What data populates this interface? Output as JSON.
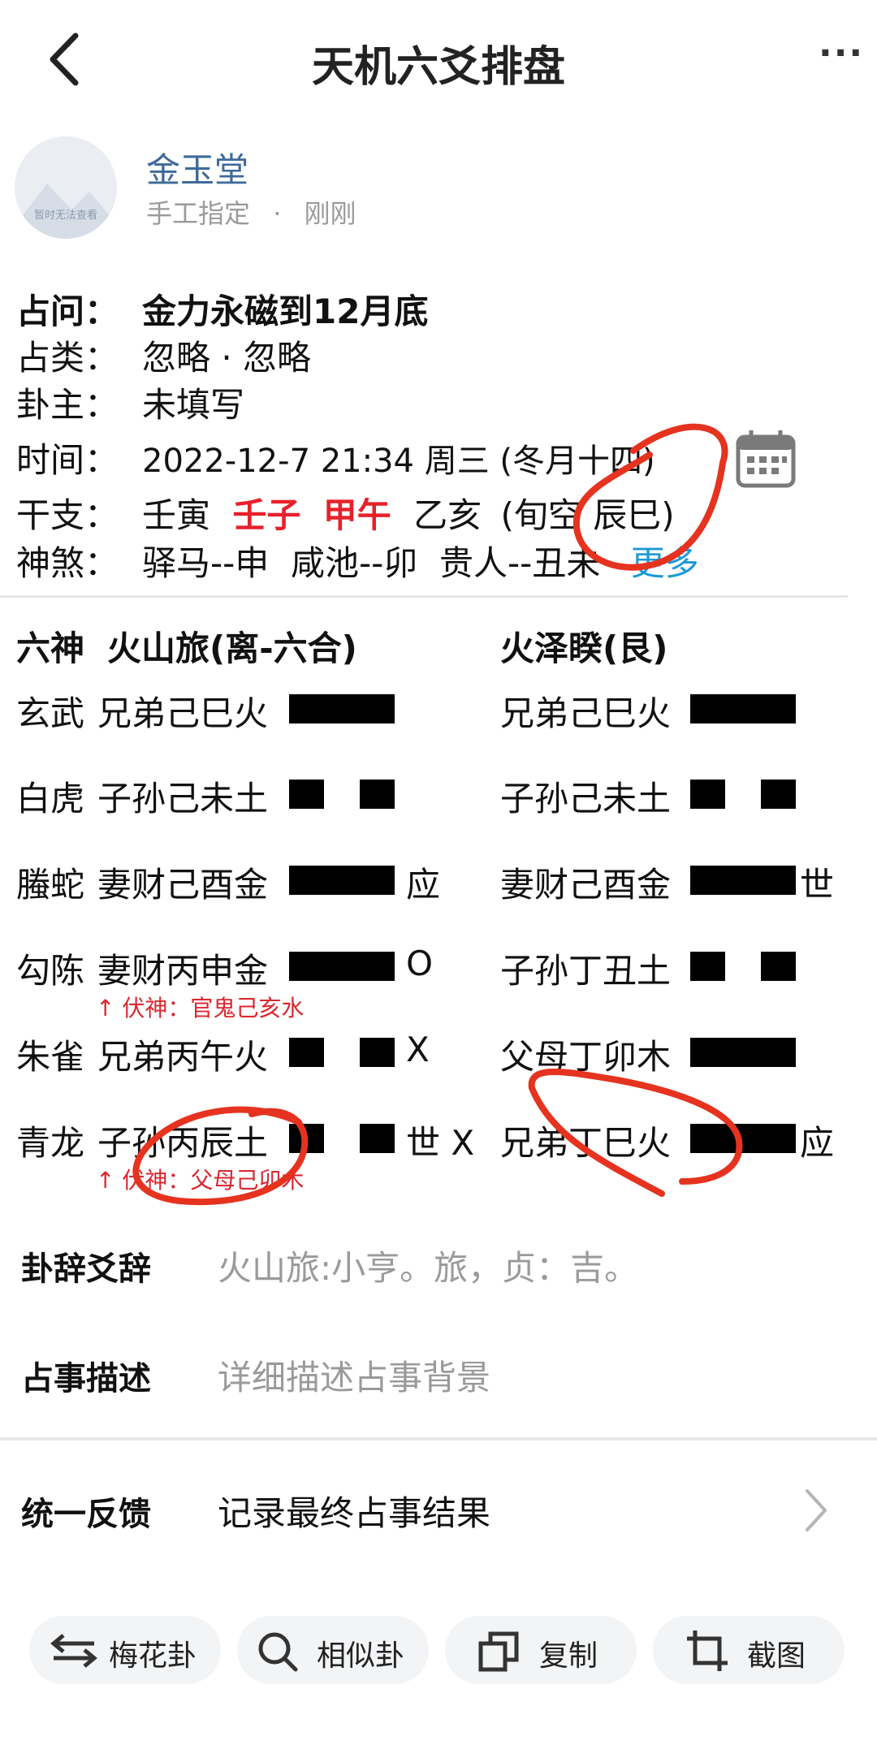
{
  "header": {
    "title": "天机六爻排盘"
  },
  "author": {
    "avatar_text": "暂时无法查看",
    "name": "金玉堂",
    "method": "手工指定",
    "separator": "·",
    "time": "刚刚"
  },
  "info": {
    "question_label": "占问：",
    "question": "金力永磁到12月底",
    "category_label": "占类：",
    "category": "忽略 · 忽略",
    "owner_label": "卦主：",
    "owner": "未填写",
    "time_label": "时间：",
    "time": "2022-12-7 21:34 周三 (冬月十四)",
    "ganzhi_label": "干支：",
    "gz_year": "壬寅",
    "gz_month": "壬子",
    "gz_day": "甲午",
    "gz_hour": "乙亥",
    "gz_void": "(旬空 辰巳)",
    "shensha_label": "神煞：",
    "shensha": "驿马--申  咸池--卯  贵人--丑未",
    "shensha_more": "更多"
  },
  "hexagram": {
    "header_liushen": "六神",
    "main_name": "火山旅(离-六合)",
    "changed_name": "火泽睽(艮)",
    "lines": [
      {
        "liushen": "玄武",
        "main": "兄弟己巳火",
        "main_yang": true,
        "mark": "",
        "changed": "兄弟己巳火",
        "changed_yang": true,
        "changed_mark": ""
      },
      {
        "liushen": "白虎",
        "main": "子孙己未土",
        "main_yang": false,
        "mark": "",
        "changed": "子孙己未土",
        "changed_yang": false,
        "changed_mark": ""
      },
      {
        "liushen": "螣蛇",
        "main": "妻财己酉金",
        "main_yang": true,
        "mark": "应",
        "changed": "妻财己酉金",
        "changed_yang": true,
        "changed_mark": "世"
      },
      {
        "liushen": "勾陈",
        "main": "妻财丙申金",
        "main_yang": true,
        "mark": "O",
        "changed": "子孙丁丑土",
        "changed_yang": false,
        "changed_mark": "",
        "fushen": "↑ 伏神：官鬼己亥水"
      },
      {
        "liushen": "朱雀",
        "main": "兄弟丙午火",
        "main_yang": false,
        "mark": "X",
        "changed": "父母丁卯木",
        "changed_yang": true,
        "changed_mark": ""
      },
      {
        "liushen": "青龙",
        "main": "子孙丙辰土",
        "main_yang": false,
        "mark": "世 X",
        "changed": "兄弟丁巳火",
        "changed_yang": true,
        "changed_mark": "应",
        "fushen": "↑ 伏神：父母己卯木"
      }
    ]
  },
  "sections": {
    "guaci_label": "卦辞爻辞",
    "guaci": "火山旅:小亨。旅，贞：吉。",
    "desc_label": "占事描述",
    "desc_placeholder": "详细描述占事背景",
    "feedback_label": "统一反馈",
    "feedback": "记录最终占事结果"
  },
  "toolbar": {
    "meihua": "梅花卦",
    "similar": "相似卦",
    "copy": "复制",
    "screenshot": "截图"
  },
  "colors": {
    "accent_red": "#e8202a",
    "link_blue": "#1a9ad6",
    "annotation_red": "#e5331f",
    "name_blue": "#3e6a9a"
  }
}
